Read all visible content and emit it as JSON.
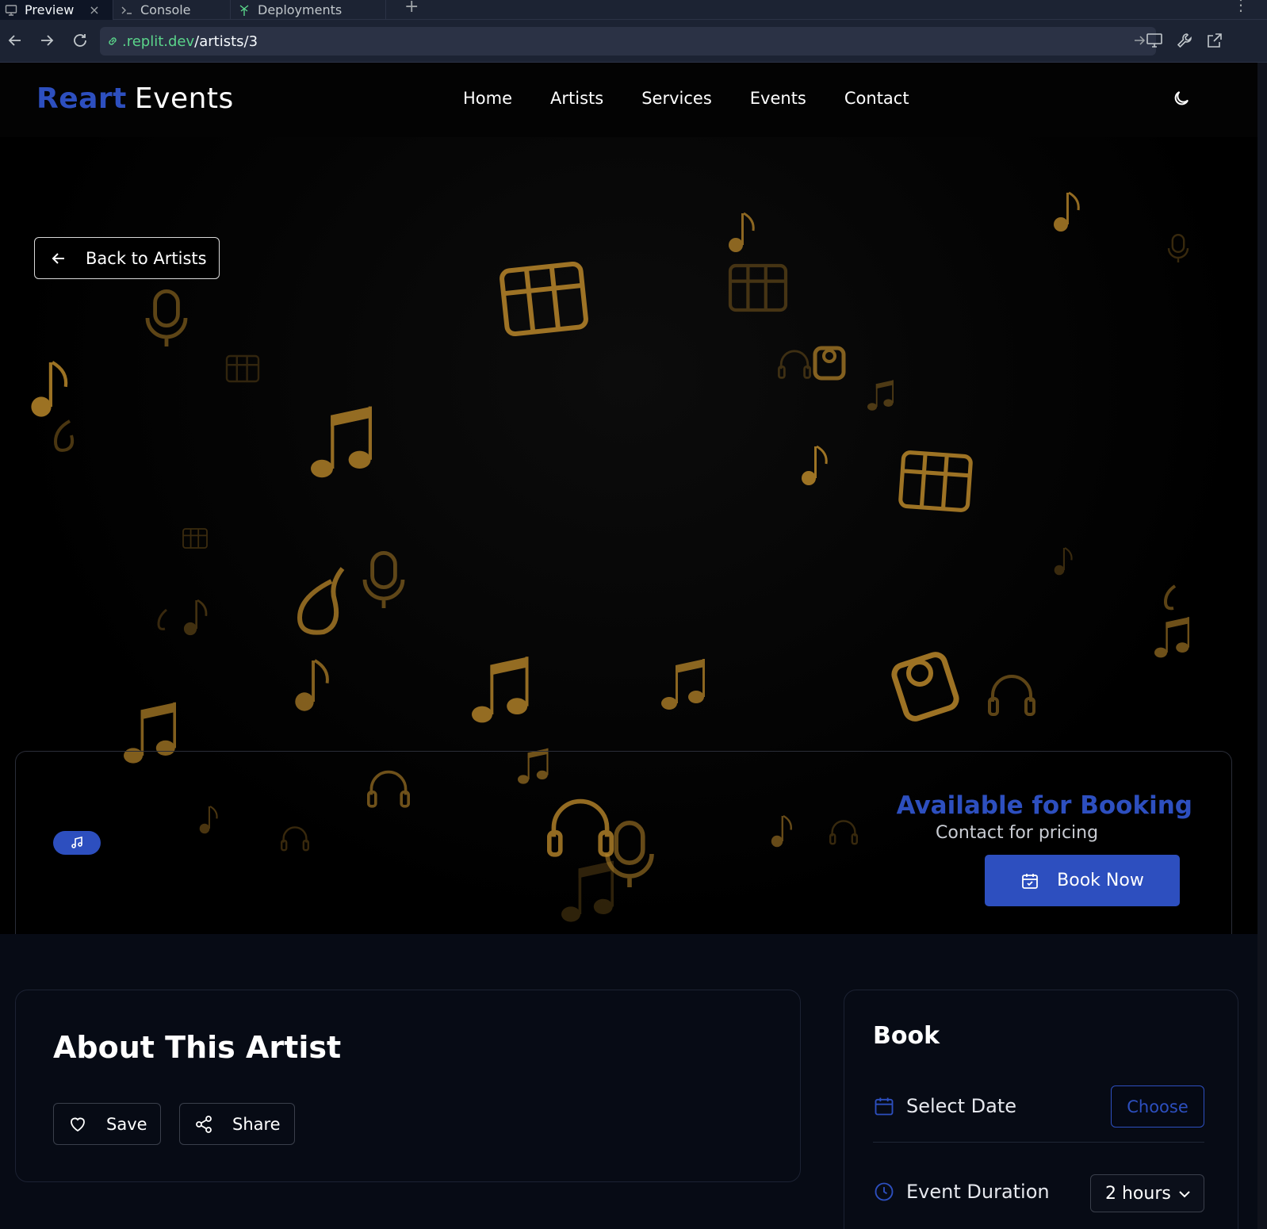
{
  "browser": {
    "tabs": [
      {
        "label": "Preview",
        "icon": "monitor-icon"
      },
      {
        "label": "Console",
        "icon": "terminal-icon"
      },
      {
        "label": "Deployments",
        "icon": "deploy-icon"
      }
    ],
    "close_glyph": "×",
    "add_glyph": "+",
    "more_glyph": "⋮",
    "url_host": ".replit.dev",
    "url_path": "/artists/3"
  },
  "site": {
    "logo_part1": "Reart",
    "logo_part2": "Events",
    "nav": [
      "Home",
      "Artists",
      "Services",
      "Events",
      "Contact"
    ],
    "accent_color": "#2d4fbf",
    "decor_color": "#b8862a"
  },
  "hero": {
    "back_label": "Back to Artists"
  },
  "artist": {
    "availability_title": "Available for Booking",
    "pricing_text": "Contact for pricing",
    "book_now_label": "Book Now",
    "genre_icon": "music-note-icon"
  },
  "about": {
    "title": "About This Artist",
    "save_label": "Save",
    "share_label": "Share"
  },
  "booking": {
    "title": "Book",
    "date_label": "Select Date",
    "choose_label": "Choose",
    "duration_label": "Event Duration",
    "duration_value": "2 hours"
  }
}
